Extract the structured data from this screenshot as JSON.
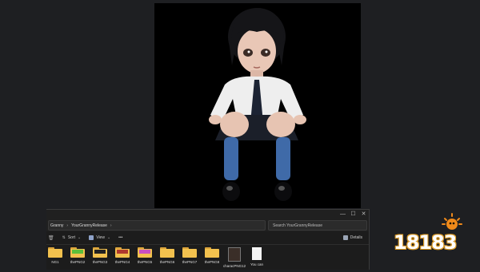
{
  "window": {
    "minimize": "—",
    "maximize": "☐",
    "close": "✕"
  },
  "address": {
    "crumbs": [
      "Granny",
      "YourGrannyRelease"
    ],
    "separator": "›",
    "search_placeholder": "Search YourGrannyRelease"
  },
  "toolbar": {
    "sort_label": "Sort",
    "view_label": "View",
    "more_label": "•••",
    "details_label": "Details"
  },
  "files": [
    {
      "label": "NG1",
      "kind": "folder",
      "stripe": ""
    },
    {
      "label": "thePNG2",
      "kind": "folder",
      "stripe": "#5cbf3a"
    },
    {
      "label": "thePNG3",
      "kind": "folder",
      "stripe": "#222222"
    },
    {
      "label": "thePNG4",
      "kind": "folder",
      "stripe": "#b0392e"
    },
    {
      "label": "thePNG5",
      "kind": "folder",
      "stripe": "#c94fc0"
    },
    {
      "label": "thePNG6",
      "kind": "folder",
      "stripe": ""
    },
    {
      "label": "thePNG7",
      "kind": "folder",
      "stripe": ""
    },
    {
      "label": "thePNG8",
      "kind": "folder",
      "stripe": ""
    },
    {
      "label": "characPNG12",
      "kind": "image",
      "stripe": ""
    },
    {
      "label": "You can",
      "kind": "document",
      "stripe": ""
    }
  ],
  "logo": {
    "text": "18183"
  }
}
